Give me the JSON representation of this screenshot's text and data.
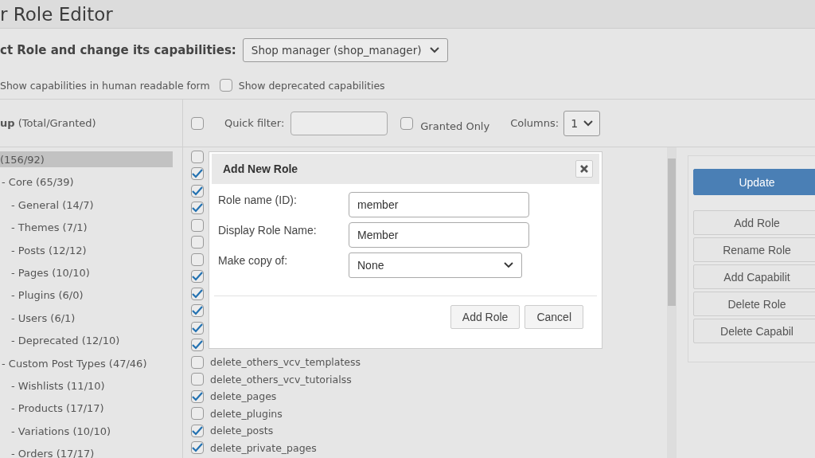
{
  "page_title": "r Role Editor",
  "role_select": {
    "label": "ct Role and change its capabilities:",
    "value": "Shop manager (shop_manager)"
  },
  "options": [
    {
      "label": "Show capabilities in human readable form"
    },
    {
      "label": "Show deprecated capabilities",
      "checked": false
    }
  ],
  "groups_header": "**up** (Total/Granted)",
  "tree": [
    {
      "label": "(156/92)",
      "selected": true,
      "children": [
        {
          "label": "- Core (65/39)",
          "selected": false,
          "children": [
            {
              "label": "- General (14/7)",
              "selected": false
            },
            {
              "label": "- Themes (7/1)",
              "selected": false
            },
            {
              "label": "- Posts (12/12)",
              "selected": false
            },
            {
              "label": "- Pages (10/10)",
              "selected": false
            },
            {
              "label": "- Plugins (6/0)",
              "selected": false
            },
            {
              "label": "- Users (6/1)",
              "selected": false
            },
            {
              "label": "- Deprecated (12/10)",
              "selected": false
            }
          ]
        },
        {
          "label": "- Custom Post Types (47/46)",
          "selected": false,
          "children": [
            {
              "label": "- Wishlists (11/10)",
              "selected": false
            },
            {
              "label": "- Products (17/17)",
              "selected": false
            },
            {
              "label": "- Variations (10/10)",
              "selected": false
            },
            {
              "label": "- Orders (17/17)",
              "selected": false
            }
          ]
        }
      ]
    }
  ],
  "toolbar": {
    "select_all_checked": false,
    "quick_filter_label": "Quick filter:",
    "granted_only": {
      "label": "Granted Only",
      "checked": false
    },
    "columns_label": "Columns:",
    "columns_value": "1"
  },
  "capabilities": [
    {
      "checked": false
    },
    {
      "checked": true
    },
    {
      "checked": true
    },
    {
      "checked": true
    },
    {
      "checked": false
    },
    {
      "checked": false
    },
    {
      "checked": false
    },
    {
      "checked": true
    },
    {
      "checked": true
    },
    {
      "checked": true
    },
    {
      "checked": true
    },
    {
      "checked": true
    },
    {
      "name": "delete_others_vcv_templatess",
      "checked": false
    },
    {
      "name": "delete_others_vcv_tutorialss",
      "checked": false
    },
    {
      "name": "delete_pages",
      "checked": true
    },
    {
      "name": "delete_plugins",
      "checked": false
    },
    {
      "name": "delete_posts",
      "checked": true
    },
    {
      "name": "delete_private_pages",
      "checked": true
    }
  ],
  "actions": [
    {
      "label": "Update",
      "kind": "primary"
    },
    {
      "label": "Add Role",
      "kind": "secondary"
    },
    {
      "label": "Rename Role",
      "kind": "secondary"
    },
    {
      "label": "Add Capabilit",
      "kind": "secondary"
    },
    {
      "label": "Delete Role",
      "kind": "secondary"
    },
    {
      "label": "Delete Capabil",
      "kind": "secondary"
    }
  ],
  "dialog": {
    "title": "Add New Role",
    "fields": [
      {
        "label": "Role name (ID):",
        "kind": "text",
        "value": "member"
      },
      {
        "label": "Display Role Name:",
        "kind": "text",
        "value": "Member"
      },
      {
        "label": "Make copy of:",
        "kind": "select",
        "value": "None"
      }
    ],
    "buttons": [
      "Add Role",
      "Cancel"
    ]
  }
}
